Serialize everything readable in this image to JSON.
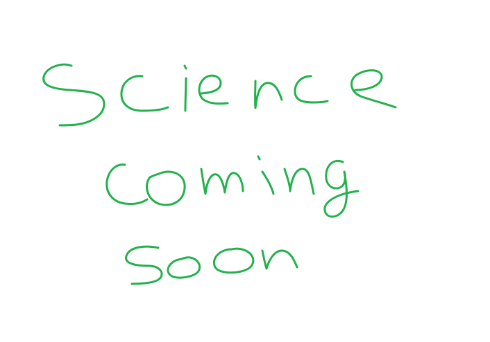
{
  "colors": {
    "background": "#ffffff",
    "ink": "#22b14c"
  },
  "lines": [
    {
      "text": "Science"
    },
    {
      "text": "Coming"
    },
    {
      "text": "soon"
    }
  ]
}
